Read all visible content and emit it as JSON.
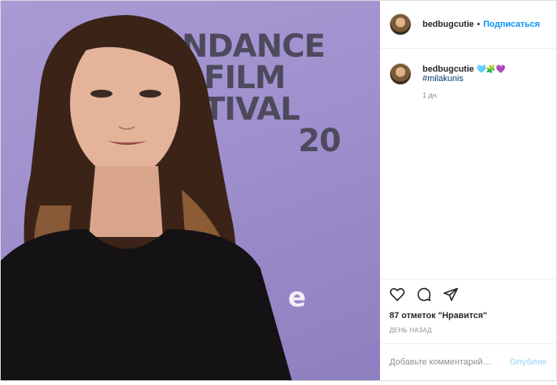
{
  "post": {
    "image_alt": "Woman with long brown hair in a black top in front of a purple Sundance Film Festival backdrop",
    "backdrop_lines": [
      "NDANCE",
      "FILM",
      "STIVAL",
      "20"
    ],
    "backdrop_e": "e"
  },
  "header": {
    "username": "bedbugcutie",
    "separator": "•",
    "follow_label": "Подписаться"
  },
  "caption": {
    "username": "bedbugcutie",
    "emoji": "🩵🧩💜",
    "hashtag": "#milakunis",
    "time": "1 дн."
  },
  "actions": {
    "like_icon": "heart-icon",
    "comment_icon": "comment-icon",
    "share_icon": "share-icon",
    "likes_text": "87 отметок \"Нравится\"",
    "posted_text": "ДЕНЬ НАЗАД"
  },
  "comment_box": {
    "placeholder": "Добавьте комментарий…",
    "publish_label": "Опублик"
  },
  "colors": {
    "backdrop": "#9f8fcd",
    "follow": "#0095f6",
    "publish_disabled": "#b2dffc"
  }
}
